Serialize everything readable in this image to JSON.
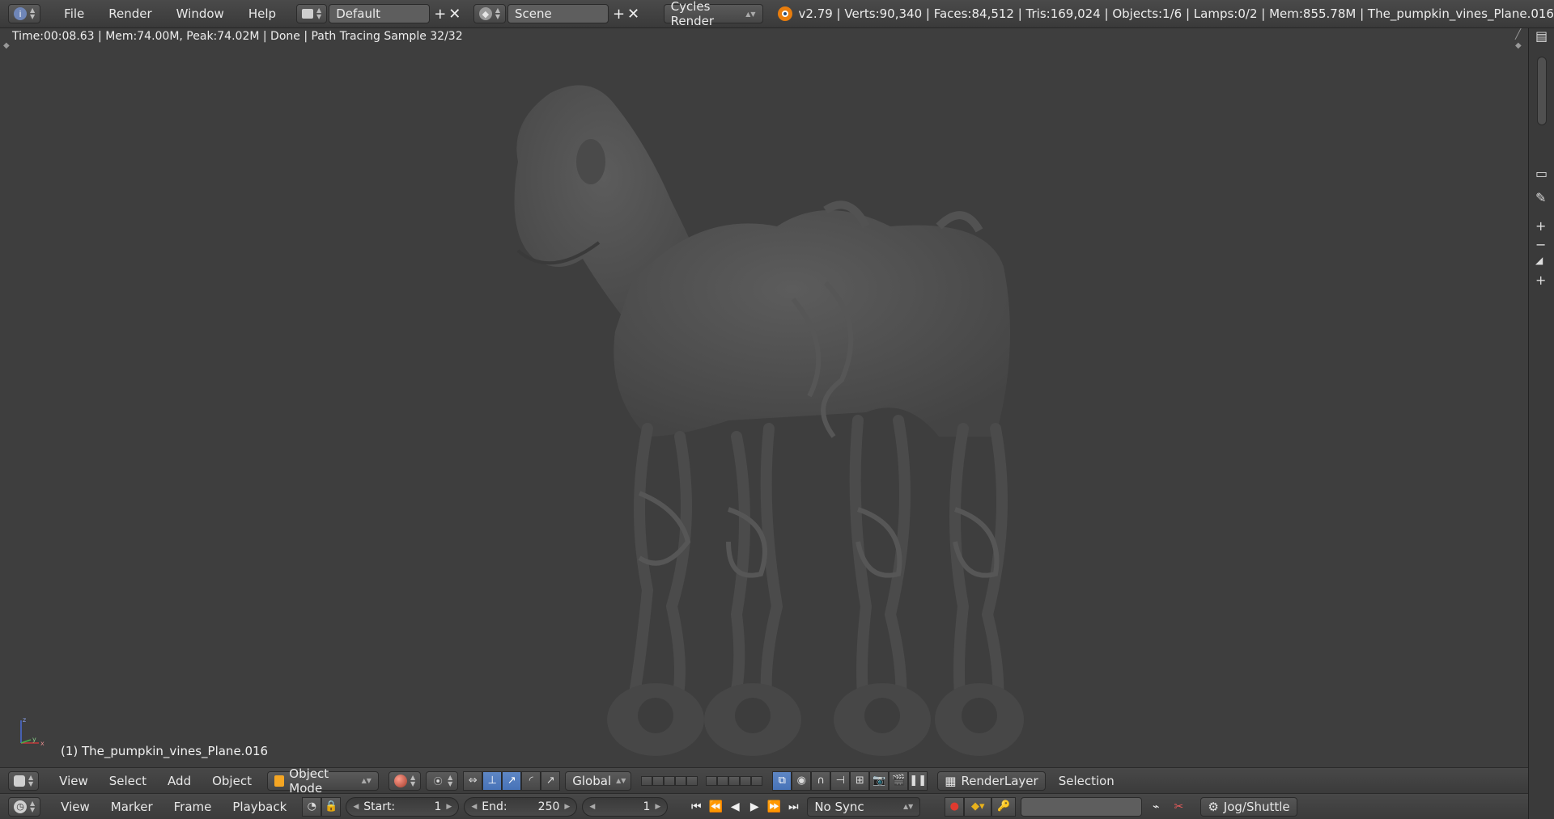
{
  "topbar": {
    "menus": [
      "File",
      "Render",
      "Window",
      "Help"
    ],
    "screen_layout": "Default",
    "scene": "Scene",
    "render_engine": "Cycles Render",
    "stats": "v2.79 | Verts:90,340 | Faces:84,512 | Tris:169,024 | Objects:1/6 | Lamps:0/2 | Mem:855.78M | The_pumpkin_vines_Plane.016"
  },
  "viewport": {
    "render_status": "Time:00:08.63 | Mem:74.00M, Peak:74.02M | Done | Path Tracing Sample 32/32",
    "object_label": "(1) The_pumpkin_vines_Plane.016",
    "axis": {
      "z": "z",
      "y": "y",
      "x": "x"
    }
  },
  "view_header": {
    "menus": [
      "View",
      "Select",
      "Add",
      "Object"
    ],
    "mode": "Object Mode",
    "orientation": "Global",
    "render_layer": "RenderLayer",
    "selection": "Selection"
  },
  "timeline": {
    "menus": [
      "View",
      "Marker",
      "Frame",
      "Playback"
    ],
    "start_label": "Start:",
    "start_value": "1",
    "end_label": "End:",
    "end_value": "250",
    "current_frame": "1",
    "sync": "No Sync",
    "jog": "Jog/Shuttle"
  },
  "colors": {
    "accent_blue": "#5680c2",
    "object_orange": "#f5a623",
    "record_red": "#e03a2f",
    "keyframe_yellow": "#e8b21c"
  }
}
